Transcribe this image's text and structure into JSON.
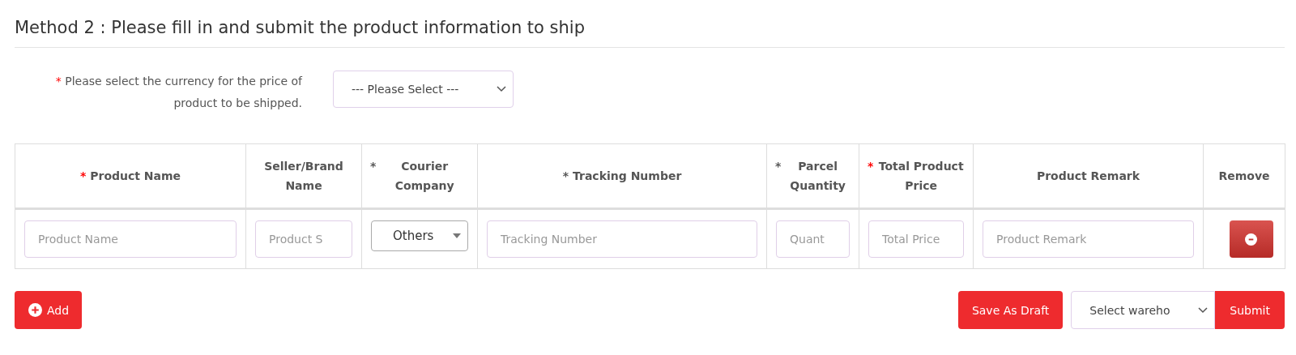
{
  "title": "Method 2 : Please fill in and submit the product information to ship",
  "currency": {
    "required_mark": "*",
    "label": "Please select the currency for the price of product to be shipped.",
    "select": "--- Please Select ---"
  },
  "table": {
    "columns": [
      {
        "required_mark": "*",
        "color": "#ff0000",
        "label": "Product Name"
      },
      {
        "label": "Seller/Brand Name"
      },
      {
        "required_mark": "*",
        "color": "#555555",
        "label": "Courier Company"
      },
      {
        "required_mark": "*",
        "color": "#555555",
        "label": "Tracking Number"
      },
      {
        "required_mark": "*",
        "color": "#555555",
        "label": "Parcel Quantity"
      },
      {
        "required_mark": "*",
        "color": "#ff0000",
        "label": "Total Product Price"
      },
      {
        "label": "Product Remark"
      },
      {
        "label": "Remove"
      }
    ],
    "rows": [
      {
        "cells": [
          {
            "kind": "input",
            "placeholder": "Product Name"
          },
          {
            "kind": "input",
            "placeholder": "Product S"
          },
          {
            "kind": "select",
            "value": "Others"
          },
          {
            "kind": "input",
            "placeholder": "Tracking Number"
          },
          {
            "kind": "input",
            "placeholder": "Quant"
          },
          {
            "kind": "input",
            "placeholder": "Total Price"
          },
          {
            "kind": "input",
            "placeholder": "Product Remark"
          },
          {
            "kind": "remove"
          }
        ]
      }
    ]
  },
  "add_button": "Add",
  "save_button": "Save As Draft",
  "warehouse_select": "Select wareho",
  "submit_button": "Submit"
}
